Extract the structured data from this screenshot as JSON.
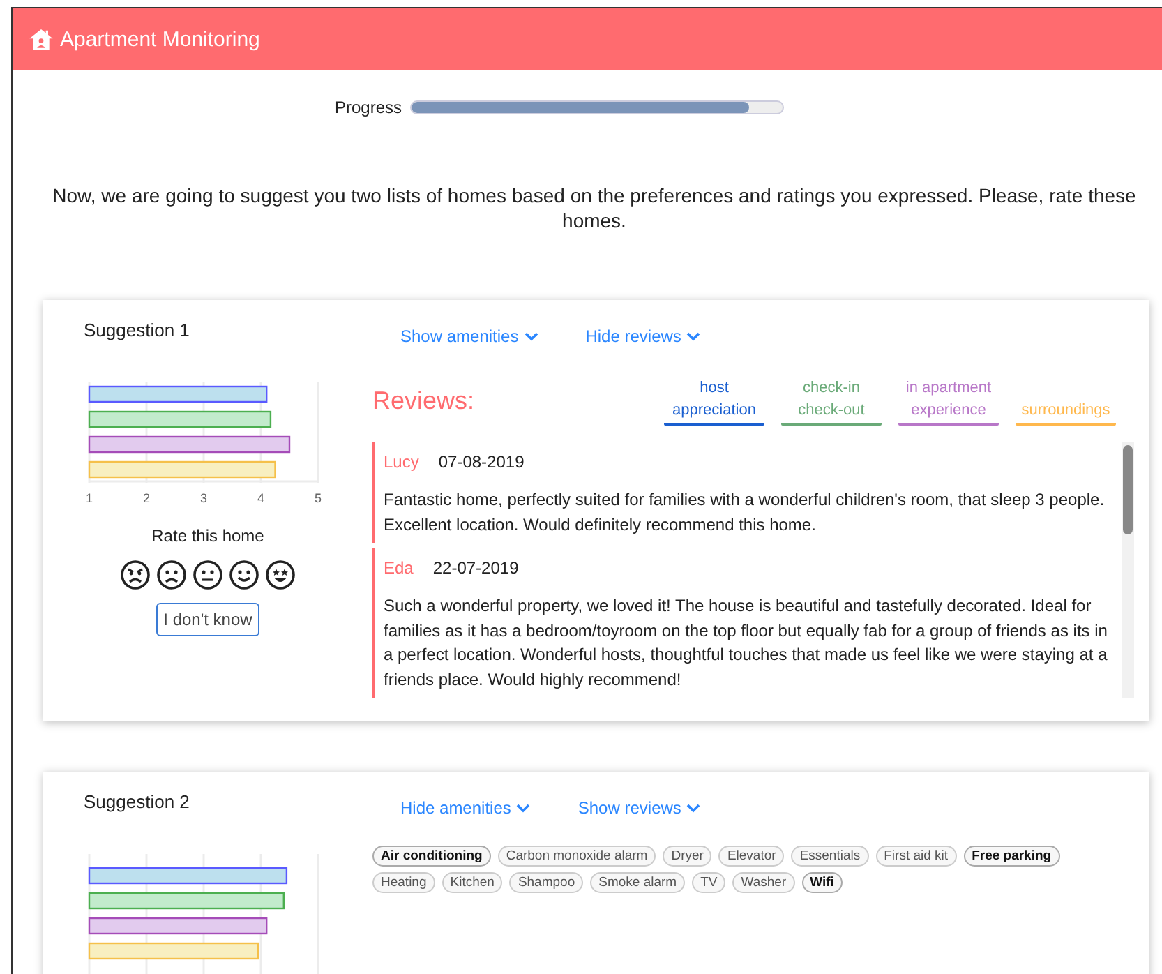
{
  "header": {
    "title": "Apartment Monitoring"
  },
  "progress": {
    "label": "Progress",
    "level": 0.91
  },
  "intro": "Now, we are going to suggest you two lists of homes based on the preferences and ratings you expressed. Please, rate these homes.",
  "suggestions": [
    {
      "title": "Suggestion 1",
      "amenities_link": "Show amenities",
      "reviews_link": "Hide reviews",
      "chart_data": {
        "type": "bar",
        "orientation": "horizontal",
        "grid": true,
        "values": [
          4.1,
          4.17,
          4.5,
          4.25
        ],
        "xlim": [
          1,
          5
        ],
        "xticks": [
          1,
          2,
          3,
          4,
          5
        ]
      },
      "rate_label": "Rate this home",
      "dont_know": "I don't know",
      "reviews_title": "Reviews:",
      "categories": [
        {
          "label": "host appreciation",
          "color": "#1a5fd0"
        },
        {
          "label": "check-in check-out",
          "color": "#6aaa78"
        },
        {
          "label": "in apartment experience",
          "color": "#b877c8"
        },
        {
          "label": "surroundings",
          "color": "#ffb84d"
        }
      ],
      "reviews": [
        {
          "name": "Lucy",
          "date": "07-08-2019",
          "text": "Fantastic home, perfectly suited for families with a wonderful children's room, that sleep 3 people. Excellent location. Would definitely recommend this home."
        },
        {
          "name": "Eda",
          "date": "22-07-2019",
          "text": "Such a wonderful property, we loved it! The house is beautiful and tastefully decorated. Ideal for families as it has a bedroom/toyroom on the top floor but equally fab for a group of friends as its in a perfect location. Wonderful hosts, thoughtful touches that made us feel like we were staying at a friends place. Would highly recommend!"
        }
      ]
    },
    {
      "title": "Suggestion 2",
      "amenities_link": "Hide amenities",
      "reviews_link": "Show reviews",
      "amenities": [
        {
          "label": "Air conditioning",
          "highlighted": true
        },
        {
          "label": "Carbon monoxide alarm",
          "highlighted": false
        },
        {
          "label": "Dryer",
          "highlighted": false
        },
        {
          "label": "Elevator",
          "highlighted": false
        },
        {
          "label": "Essentials",
          "highlighted": false
        },
        {
          "label": "First aid kit",
          "highlighted": false
        },
        {
          "label": "Free parking",
          "highlighted": true
        },
        {
          "label": "Heating",
          "highlighted": false
        },
        {
          "label": "Kitchen",
          "highlighted": false
        },
        {
          "label": "Shampoo",
          "highlighted": false
        },
        {
          "label": "Smoke alarm",
          "highlighted": false
        },
        {
          "label": "TV",
          "highlighted": false
        },
        {
          "label": "Washer",
          "highlighted": false
        },
        {
          "label": "Wifi",
          "highlighted": true
        }
      ]
    }
  ]
}
